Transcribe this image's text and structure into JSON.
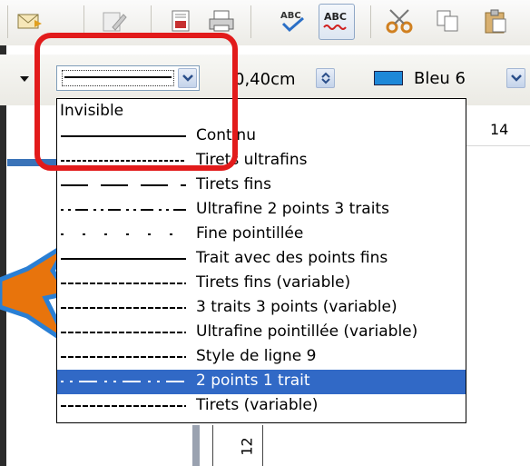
{
  "toolbar": {
    "icons": [
      "send-icon",
      "edit-icon",
      "export-pdf-icon",
      "print-icon",
      "spellcheck-icon",
      "auto-spellcheck-icon",
      "cut-icon",
      "copy-icon",
      "paste-icon"
    ],
    "abc_label": "ABC"
  },
  "line_toolbar": {
    "width_value": "0,40cm",
    "color_name": "Bleu 6",
    "color_hex": "#1e88d8"
  },
  "ruler": {
    "label": "14",
    "vertical_label": "12"
  },
  "line_styles": {
    "selected_index": 11,
    "items": [
      {
        "label": "Invisible",
        "pattern": "none"
      },
      {
        "label": "Continu",
        "pattern": "solid"
      },
      {
        "label": "Tirets ultrafins",
        "pattern": "dash-ultrafine"
      },
      {
        "label": "Tirets fins",
        "pattern": "dash-fine"
      },
      {
        "label": "Ultrafine 2 points 3 traits",
        "pattern": "dots2-dash3"
      },
      {
        "label": "Fine pointillée",
        "pattern": "dotted-sparse"
      },
      {
        "label": "Trait avec des points fins",
        "pattern": "solid"
      },
      {
        "label": "Tirets fins (variable)",
        "pattern": "dash-small"
      },
      {
        "label": "3 traits 3 points (variable)",
        "pattern": "dash-small"
      },
      {
        "label": "Ultrafine pointillée (variable)",
        "pattern": "dash-small"
      },
      {
        "label": "Style de ligne 9",
        "pattern": "dash-small"
      },
      {
        "label": "2 points 1 trait",
        "pattern": "dots2-dash1"
      },
      {
        "label": "Tirets (variable)",
        "pattern": "dash-small"
      }
    ]
  },
  "colors": {
    "highlight": "#e21b1b",
    "selection": "#3169c6"
  }
}
